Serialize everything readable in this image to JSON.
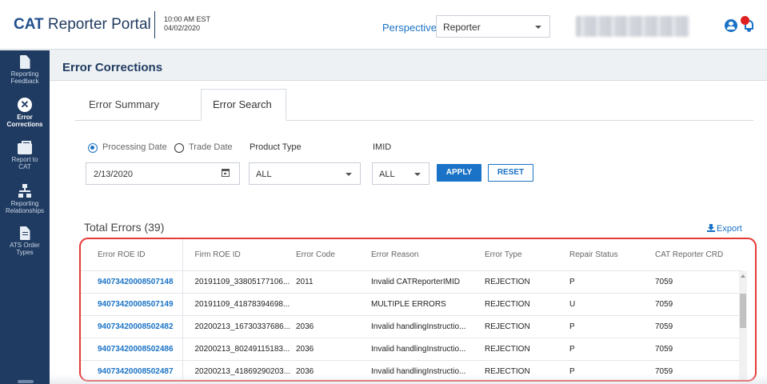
{
  "header": {
    "brand_bold": "CAT",
    "brand_rest": " Reporter Portal",
    "time": "10:00 AM EST",
    "date": "04/02/2020",
    "perspective_label": "Perspective",
    "perspective_value": "Reporter",
    "user_icon": "user-circle-icon",
    "notification_icon": "bell-icon"
  },
  "sidebar": {
    "items": [
      {
        "label_line1": "Reporting",
        "label_line2": "Feedback",
        "icon": "document-icon",
        "active": false
      },
      {
        "label_line1": "Error",
        "label_line2": "Corrections",
        "icon": "close-circle-icon",
        "active": true
      },
      {
        "label_line1": "Report to",
        "label_line2": "CAT",
        "icon": "briefcase-icon",
        "active": false
      },
      {
        "label_line1": "Reporting",
        "label_line2": "Relationships",
        "icon": "network-icon",
        "active": false
      },
      {
        "label_line1": "ATS Order",
        "label_line2": "Types",
        "icon": "document-lines-icon",
        "active": false
      }
    ]
  },
  "page": {
    "title": "Error Corrections"
  },
  "tabs": [
    {
      "label": "Error Summary",
      "active": false
    },
    {
      "label": "Error Search",
      "active": true
    }
  ],
  "filters": {
    "radio_processing_date": "Processing Date",
    "radio_trade_date": "Trade Date",
    "selected_radio": "Processing Date",
    "product_type_label": "Product Type",
    "imid_label": "IMID",
    "date_value": "2/13/2020",
    "product_type_value": "ALL",
    "imid_value": "ALL",
    "apply_label": "APPLY",
    "reset_label": "RESET"
  },
  "results": {
    "total_label": "Total Errors (39)",
    "export_label": "Export",
    "columns": [
      "Error ROE ID",
      "Firm ROE ID",
      "Error Code",
      "Error Reason",
      "Error Type",
      "Repair Status",
      "CAT Reporter CRD"
    ],
    "rows": [
      [
        "94073420008507148",
        "20191109_33805177106...",
        "2011",
        "Invalid CATReporterIMID",
        "REJECTION",
        "P",
        "7059"
      ],
      [
        "94073420008507149",
        "20191109_41878394698...",
        "",
        "MULTIPLE ERRORS",
        "REJECTION",
        "U",
        "7059"
      ],
      [
        "94073420008502482",
        "20200213_16730337686...",
        "2036",
        "Invalid handlingInstructio...",
        "REJECTION",
        "P",
        "7059"
      ],
      [
        "94073420008502486",
        "20200213_80249115183...",
        "2036",
        "Invalid handlingInstructio...",
        "REJECTION",
        "P",
        "7059"
      ],
      [
        "94073420008502487",
        "20200213_41869290203...",
        "2036",
        "Invalid handlingInstructio...",
        "REJECTION",
        "P",
        "7059"
      ]
    ]
  },
  "colors": {
    "brand_blue": "#1f4e8c",
    "sidebar_bg": "#1f3b61",
    "accent": "#1a73c6",
    "highlight_border": "#e53935"
  }
}
